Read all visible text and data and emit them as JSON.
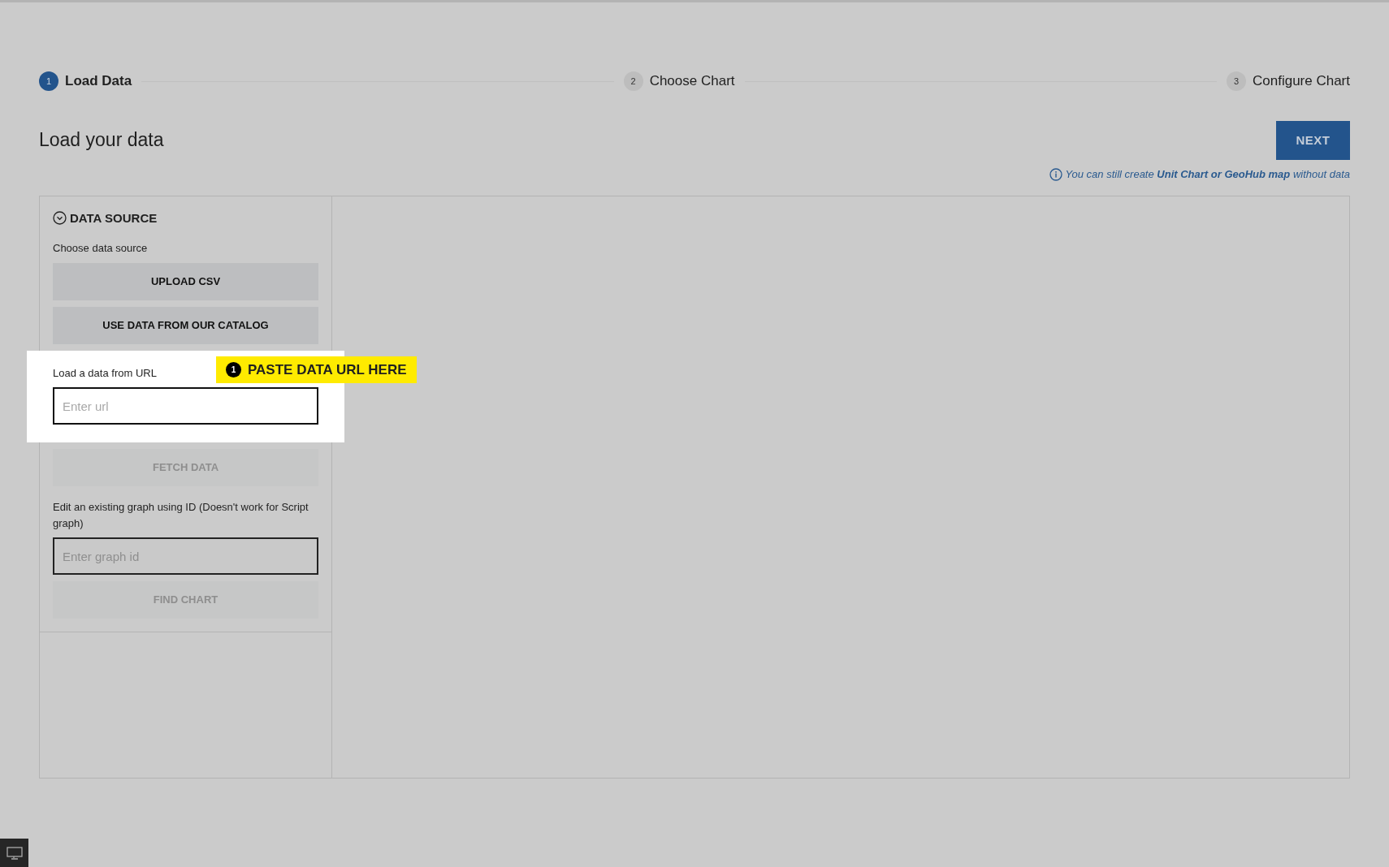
{
  "steps": [
    {
      "number": "1",
      "label": "Load Data",
      "selected": true
    },
    {
      "number": "2",
      "label": "Choose Chart",
      "selected": false
    },
    {
      "number": "3",
      "label": "Configure Chart",
      "selected": false
    }
  ],
  "header": {
    "title": "Load your data",
    "next_button": "NEXT",
    "hint": "You can still create **Unit Chart or GeoHub map** without data"
  },
  "data_source": {
    "title": "DATA SOURCE",
    "expanded": true,
    "choose_label": "Choose data source",
    "buttons": [
      "UPLOAD CSV",
      "USE DATA FROM OUR CATALOG"
    ],
    "url_label": "Load a data from URL",
    "url_field": {
      "placeholder": "Enter url"
    },
    "fetch_button": {
      "label": "FETCH DATA",
      "disabled": true
    },
    "id_label": "Edit an existing graph using ID (Doesn't work for Script graph)",
    "id_field": {
      "placeholder": "Enter graph id"
    },
    "find_button": {
      "label": "FIND CHART",
      "disabled": true
    }
  },
  "callout": {
    "number": "1",
    "text": "PASTE DATA URL HERE"
  }
}
